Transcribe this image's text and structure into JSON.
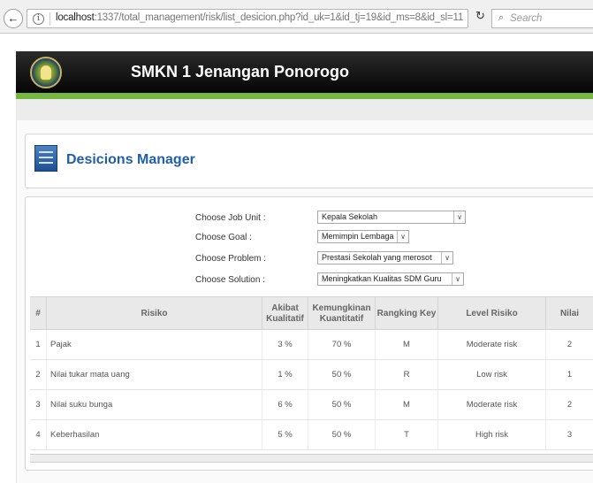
{
  "browser": {
    "back_glyph": "←",
    "info_glyph": "i",
    "url_host": "localhost",
    "url_path": ":1337/total_management/risk/list_desicion.php?id_uk=1&id_tj=19&id_ms=8&id_sl=11",
    "reload_glyph": "↻",
    "search_glyph": "⌕",
    "search_placeholder": "Search",
    "icons": [
      "back-arrow-icon",
      "info-icon",
      "reload-icon",
      "search-icon"
    ]
  },
  "header": {
    "title": "SMKN 1 Jenangan Ponorogo",
    "colors": {
      "bar": "#111111",
      "accent": "#76b83f"
    }
  },
  "page": {
    "title": "Desicions Manager",
    "title_color": "#1f5fab"
  },
  "form": {
    "fields": [
      {
        "label": "Choose Job Unit :",
        "value": "Kepala Sekolah"
      },
      {
        "label": "Choose Goal :",
        "value": "Memimpin Lembaga"
      },
      {
        "label": "Choose Problem :",
        "value": "Prestasi Sekolah yang merosot"
      },
      {
        "label": "Choose Solution :",
        "value": "Meningkatkan Kualitas SDM Guru"
      }
    ],
    "dropdown_glyph": "∨"
  },
  "table": {
    "headers": {
      "num": "#",
      "risk": "Risiko",
      "akibat_1": "Akibat",
      "akibat_2": "Kualitatif",
      "kemungkinan_1": "Kemungkinan",
      "kemungkinan_2": "Kuantitatif",
      "rank": "Rangking Key",
      "level": "Level Risiko",
      "nilai": "Nilai"
    },
    "rows": [
      {
        "num": "1",
        "risk": "Pajak",
        "akibat": "3 %",
        "kemungkinan": "70 %",
        "rank": "M",
        "level": "Moderate risk",
        "nilai": "2"
      },
      {
        "num": "2",
        "risk": "Nilai tukar mata uang",
        "akibat": "1 %",
        "kemungkinan": "50 %",
        "rank": "R",
        "level": "Low risk",
        "nilai": "1"
      },
      {
        "num": "3",
        "risk": "Nilai suku bunga",
        "akibat": "6 %",
        "kemungkinan": "50 %",
        "rank": "M",
        "level": "Moderate risk",
        "nilai": "2"
      },
      {
        "num": "4",
        "risk": "Keberhasilan",
        "akibat": "5 %",
        "kemungkinan": "50 %",
        "rank": "T",
        "level": "High risk",
        "nilai": "3"
      }
    ]
  }
}
